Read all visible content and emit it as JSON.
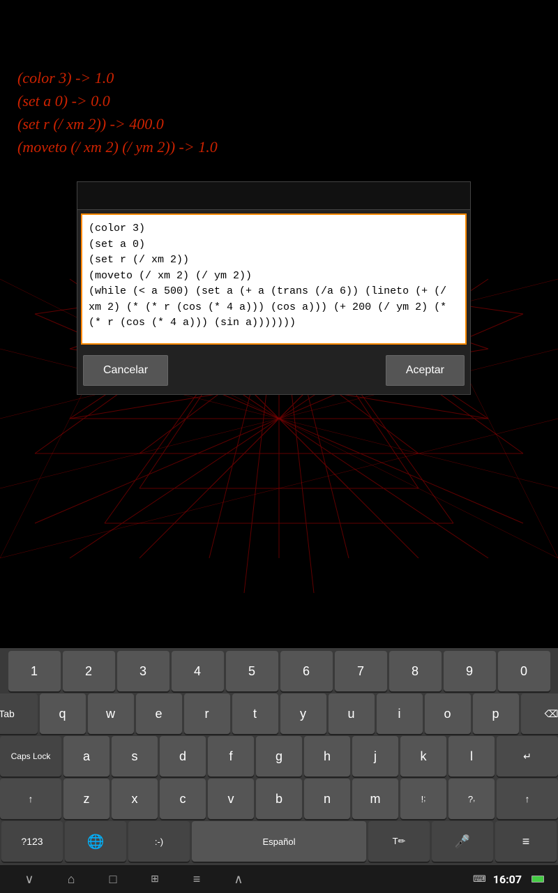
{
  "app": {
    "bg_color": "#000000"
  },
  "code_output": {
    "lines": [
      "(color 3) -> 1.0",
      "(set a 0) -> 0.0",
      "(set r (/ xm 2)) -> 400.0",
      "(moveto (/ xm 2) (/ ym 2)) -> 1.0"
    ]
  },
  "dialog": {
    "textarea_content": "(color 3)\n(set a 0)\n(set r (/ xm 2))\n(moveto (/ xm 2) (/ ym 2))\n(while (< a 500) (set a (+ a (trans (/a 6)) (lineto (+ (/ xm 2) (* (* r (cos (* 4 a))) (cos a))) (+ 200 (/ ym 2) (* (* r (cos (* 4 a))) (sin a)))))))",
    "cancel_label": "Cancelar",
    "accept_label": "Aceptar"
  },
  "keyboard": {
    "row1": [
      "1",
      "2",
      "3",
      "4",
      "5",
      "6",
      "7",
      "8",
      "9",
      "0"
    ],
    "row2_special": "Tab",
    "row2": [
      "q",
      "w",
      "e",
      "r",
      "t",
      "y",
      "u",
      "i",
      "o",
      "p"
    ],
    "row3_special": "Caps Lock",
    "row3": [
      "a",
      "s",
      "d",
      "f",
      "g",
      "h",
      "j",
      "k",
      "l"
    ],
    "row4_shift": "↑",
    "row4": [
      "z",
      "x",
      "c",
      "v",
      "b",
      "n",
      "m"
    ],
    "row4_punct": [
      ";!",
      "?,"
    ],
    "row4_shift2": "↑",
    "row5_num": "?123",
    "row5_globe": "🌐",
    "row5_smiley": ":-)",
    "row5_space_lang": "Español",
    "row5_edit": "T/",
    "row5_mic": "🎤",
    "row5_menu": "≡"
  },
  "nav_bar": {
    "back_icon": "∨",
    "home_icon": "⌂",
    "recents_icon": "□",
    "qr_icon": "⊞",
    "menu_icon": "≡",
    "up_icon": "∧",
    "keyboard_icon": "⌨",
    "clock": "16:07",
    "battery_full": true,
    "signal_icon": "▋▋▋"
  }
}
